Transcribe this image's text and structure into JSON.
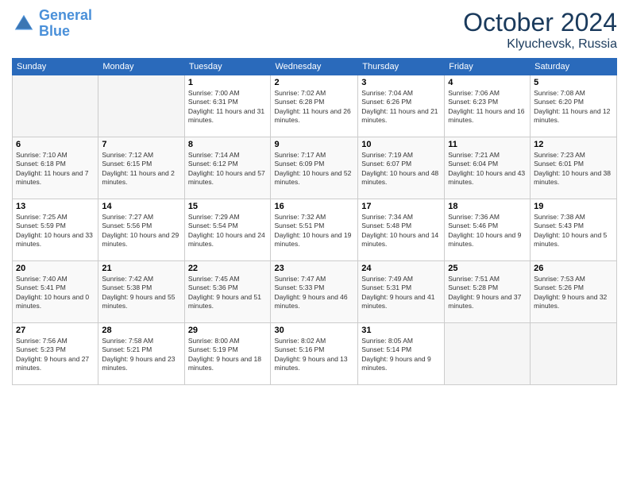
{
  "header": {
    "logo_line1": "General",
    "logo_line2": "Blue",
    "month": "October 2024",
    "location": "Klyuchevsk, Russia"
  },
  "weekdays": [
    "Sunday",
    "Monday",
    "Tuesday",
    "Wednesday",
    "Thursday",
    "Friday",
    "Saturday"
  ],
  "weeks": [
    [
      {
        "day": "",
        "sunrise": "",
        "sunset": "",
        "daylight": ""
      },
      {
        "day": "",
        "sunrise": "",
        "sunset": "",
        "daylight": ""
      },
      {
        "day": "1",
        "sunrise": "Sunrise: 7:00 AM",
        "sunset": "Sunset: 6:31 PM",
        "daylight": "Daylight: 11 hours and 31 minutes."
      },
      {
        "day": "2",
        "sunrise": "Sunrise: 7:02 AM",
        "sunset": "Sunset: 6:28 PM",
        "daylight": "Daylight: 11 hours and 26 minutes."
      },
      {
        "day": "3",
        "sunrise": "Sunrise: 7:04 AM",
        "sunset": "Sunset: 6:26 PM",
        "daylight": "Daylight: 11 hours and 21 minutes."
      },
      {
        "day": "4",
        "sunrise": "Sunrise: 7:06 AM",
        "sunset": "Sunset: 6:23 PM",
        "daylight": "Daylight: 11 hours and 16 minutes."
      },
      {
        "day": "5",
        "sunrise": "Sunrise: 7:08 AM",
        "sunset": "Sunset: 6:20 PM",
        "daylight": "Daylight: 11 hours and 12 minutes."
      }
    ],
    [
      {
        "day": "6",
        "sunrise": "Sunrise: 7:10 AM",
        "sunset": "Sunset: 6:18 PM",
        "daylight": "Daylight: 11 hours and 7 minutes."
      },
      {
        "day": "7",
        "sunrise": "Sunrise: 7:12 AM",
        "sunset": "Sunset: 6:15 PM",
        "daylight": "Daylight: 11 hours and 2 minutes."
      },
      {
        "day": "8",
        "sunrise": "Sunrise: 7:14 AM",
        "sunset": "Sunset: 6:12 PM",
        "daylight": "Daylight: 10 hours and 57 minutes."
      },
      {
        "day": "9",
        "sunrise": "Sunrise: 7:17 AM",
        "sunset": "Sunset: 6:09 PM",
        "daylight": "Daylight: 10 hours and 52 minutes."
      },
      {
        "day": "10",
        "sunrise": "Sunrise: 7:19 AM",
        "sunset": "Sunset: 6:07 PM",
        "daylight": "Daylight: 10 hours and 48 minutes."
      },
      {
        "day": "11",
        "sunrise": "Sunrise: 7:21 AM",
        "sunset": "Sunset: 6:04 PM",
        "daylight": "Daylight: 10 hours and 43 minutes."
      },
      {
        "day": "12",
        "sunrise": "Sunrise: 7:23 AM",
        "sunset": "Sunset: 6:01 PM",
        "daylight": "Daylight: 10 hours and 38 minutes."
      }
    ],
    [
      {
        "day": "13",
        "sunrise": "Sunrise: 7:25 AM",
        "sunset": "Sunset: 5:59 PM",
        "daylight": "Daylight: 10 hours and 33 minutes."
      },
      {
        "day": "14",
        "sunrise": "Sunrise: 7:27 AM",
        "sunset": "Sunset: 5:56 PM",
        "daylight": "Daylight: 10 hours and 29 minutes."
      },
      {
        "day": "15",
        "sunrise": "Sunrise: 7:29 AM",
        "sunset": "Sunset: 5:54 PM",
        "daylight": "Daylight: 10 hours and 24 minutes."
      },
      {
        "day": "16",
        "sunrise": "Sunrise: 7:32 AM",
        "sunset": "Sunset: 5:51 PM",
        "daylight": "Daylight: 10 hours and 19 minutes."
      },
      {
        "day": "17",
        "sunrise": "Sunrise: 7:34 AM",
        "sunset": "Sunset: 5:48 PM",
        "daylight": "Daylight: 10 hours and 14 minutes."
      },
      {
        "day": "18",
        "sunrise": "Sunrise: 7:36 AM",
        "sunset": "Sunset: 5:46 PM",
        "daylight": "Daylight: 10 hours and 9 minutes."
      },
      {
        "day": "19",
        "sunrise": "Sunrise: 7:38 AM",
        "sunset": "Sunset: 5:43 PM",
        "daylight": "Daylight: 10 hours and 5 minutes."
      }
    ],
    [
      {
        "day": "20",
        "sunrise": "Sunrise: 7:40 AM",
        "sunset": "Sunset: 5:41 PM",
        "daylight": "Daylight: 10 hours and 0 minutes."
      },
      {
        "day": "21",
        "sunrise": "Sunrise: 7:42 AM",
        "sunset": "Sunset: 5:38 PM",
        "daylight": "Daylight: 9 hours and 55 minutes."
      },
      {
        "day": "22",
        "sunrise": "Sunrise: 7:45 AM",
        "sunset": "Sunset: 5:36 PM",
        "daylight": "Daylight: 9 hours and 51 minutes."
      },
      {
        "day": "23",
        "sunrise": "Sunrise: 7:47 AM",
        "sunset": "Sunset: 5:33 PM",
        "daylight": "Daylight: 9 hours and 46 minutes."
      },
      {
        "day": "24",
        "sunrise": "Sunrise: 7:49 AM",
        "sunset": "Sunset: 5:31 PM",
        "daylight": "Daylight: 9 hours and 41 minutes."
      },
      {
        "day": "25",
        "sunrise": "Sunrise: 7:51 AM",
        "sunset": "Sunset: 5:28 PM",
        "daylight": "Daylight: 9 hours and 37 minutes."
      },
      {
        "day": "26",
        "sunrise": "Sunrise: 7:53 AM",
        "sunset": "Sunset: 5:26 PM",
        "daylight": "Daylight: 9 hours and 32 minutes."
      }
    ],
    [
      {
        "day": "27",
        "sunrise": "Sunrise: 7:56 AM",
        "sunset": "Sunset: 5:23 PM",
        "daylight": "Daylight: 9 hours and 27 minutes."
      },
      {
        "day": "28",
        "sunrise": "Sunrise: 7:58 AM",
        "sunset": "Sunset: 5:21 PM",
        "daylight": "Daylight: 9 hours and 23 minutes."
      },
      {
        "day": "29",
        "sunrise": "Sunrise: 8:00 AM",
        "sunset": "Sunset: 5:19 PM",
        "daylight": "Daylight: 9 hours and 18 minutes."
      },
      {
        "day": "30",
        "sunrise": "Sunrise: 8:02 AM",
        "sunset": "Sunset: 5:16 PM",
        "daylight": "Daylight: 9 hours and 13 minutes."
      },
      {
        "day": "31",
        "sunrise": "Sunrise: 8:05 AM",
        "sunset": "Sunset: 5:14 PM",
        "daylight": "Daylight: 9 hours and 9 minutes."
      },
      {
        "day": "",
        "sunrise": "",
        "sunset": "",
        "daylight": ""
      },
      {
        "day": "",
        "sunrise": "",
        "sunset": "",
        "daylight": ""
      }
    ]
  ]
}
